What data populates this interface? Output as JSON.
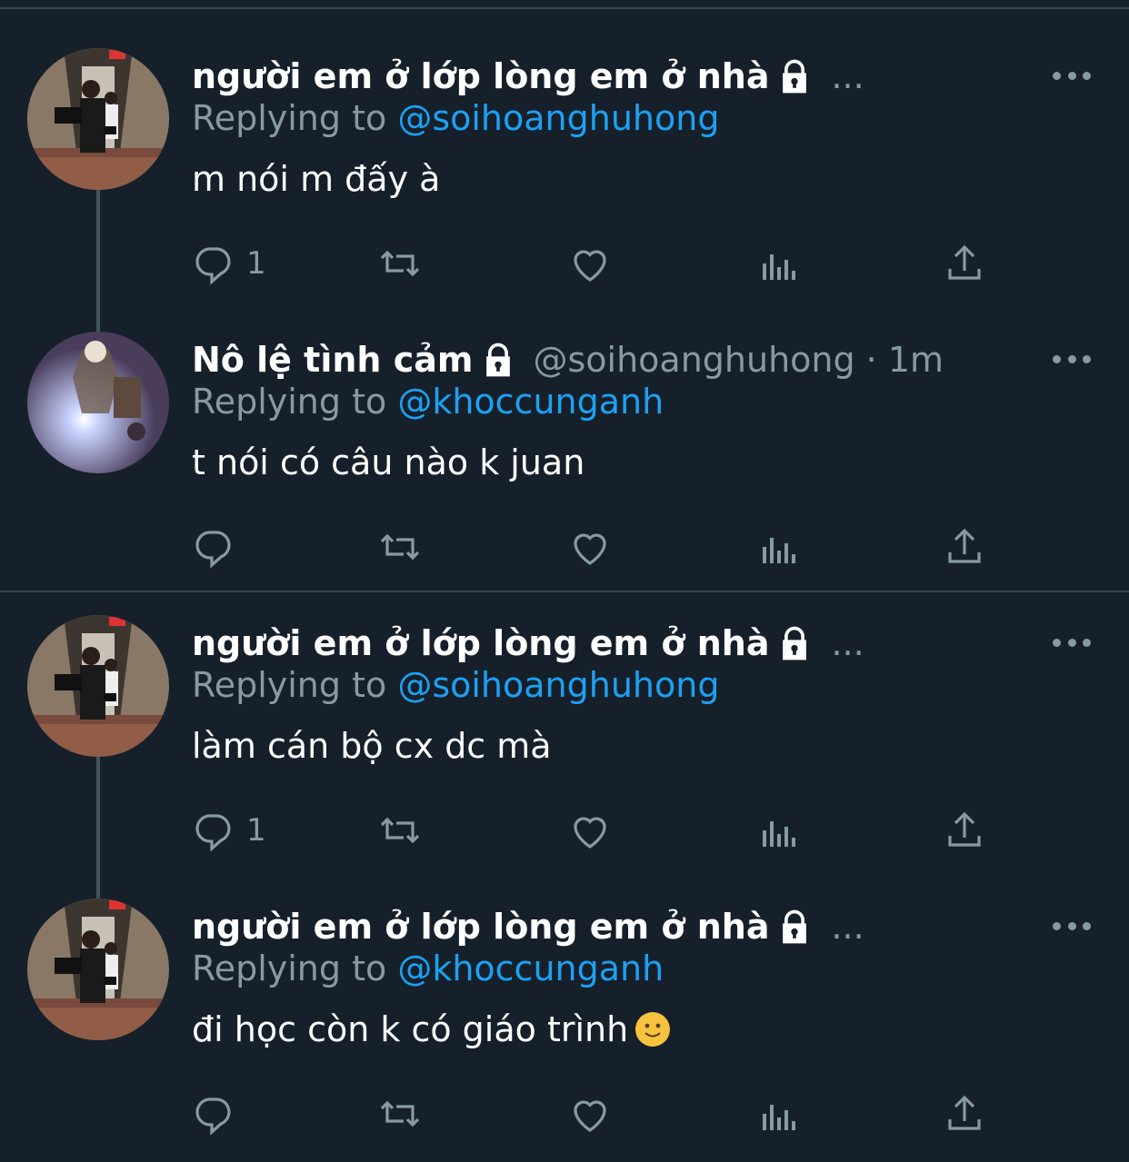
{
  "colors": {
    "background": "#15202b",
    "divider": "#38444d",
    "text_primary": "#ffffff",
    "text_secondary": "#8899a6",
    "link": "#1da1f2"
  },
  "icons": [
    "lock-icon",
    "more-icon",
    "reply-icon",
    "retweet-icon",
    "like-icon",
    "analytics-icon",
    "share-icon"
  ],
  "tweets": [
    {
      "name": "người em ở lớp lòng em ở nhà",
      "handle": "",
      "truncation": "...",
      "reply_prefix": "Replying to",
      "reply_to": "@soihoanghuhong",
      "text": "m nói m đấy à",
      "reply_count": "1"
    },
    {
      "name": "Nô lệ tình cảm",
      "handle": "@soihoanghuhong · 1m",
      "truncation": "",
      "reply_prefix": "Replying to",
      "reply_to": "@khoccunganh",
      "text": "t nói có câu nào k juan",
      "reply_count": ""
    },
    {
      "name": "người em ở lớp lòng em ở nhà",
      "handle": "",
      "truncation": "...",
      "reply_prefix": "Replying to",
      "reply_to": "@soihoanghuhong",
      "text": "làm cán bộ cx dc mà",
      "reply_count": "1"
    },
    {
      "name": "người em ở lớp lòng em ở nhà",
      "handle": "",
      "truncation": "...",
      "reply_prefix": "Replying to",
      "reply_to": "@khoccunganh",
      "text": "đi học còn k có giáo trình",
      "reply_count": ""
    }
  ]
}
